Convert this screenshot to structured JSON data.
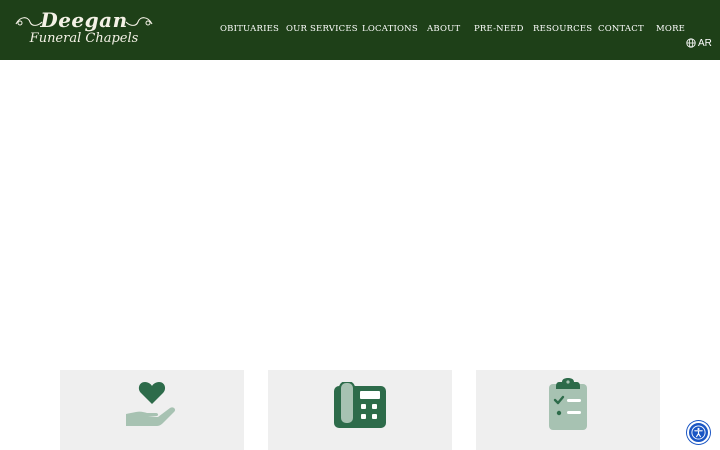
{
  "brand": {
    "name": "Deegan",
    "subtitle": "Funeral Chapels"
  },
  "nav": {
    "items": [
      {
        "label": "OBITUARIES"
      },
      {
        "label": "OUR SERVICES"
      },
      {
        "label": "LOCATIONS"
      },
      {
        "label": "ABOUT"
      },
      {
        "label": "PRE-NEED"
      },
      {
        "label": "RESOURCES"
      },
      {
        "label": "CONTACT"
      },
      {
        "label": "MORE"
      }
    ]
  },
  "language": {
    "label": "AR",
    "icon": "globe-icon"
  },
  "cards": [
    {
      "icon": "heart-hand-icon"
    },
    {
      "icon": "phone-icon"
    },
    {
      "icon": "clipboard-checklist-icon"
    }
  ],
  "accessibility": {
    "icon": "accessibility-icon"
  },
  "colors": {
    "header_bg": "#1e4018",
    "icon_dark": "#2d6b4a",
    "icon_light": "#a7c2b2",
    "card_bg": "#efefef",
    "accessibility_blue": "#1a56c4"
  }
}
